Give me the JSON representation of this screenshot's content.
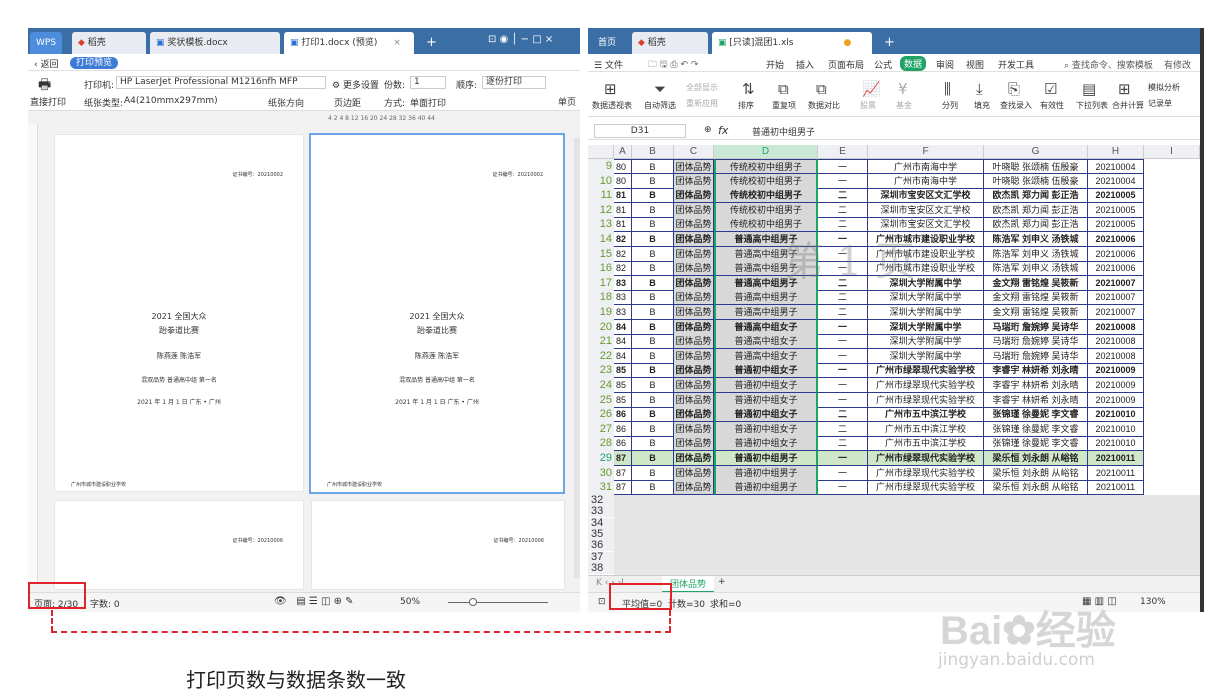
{
  "left_window": {
    "tabs": {
      "wps": "WPS",
      "stencil": "稻壳",
      "doc1": "奖状模板.docx",
      "doc2": "打印1.docx (预览)",
      "add": "+"
    },
    "nav": {
      "back": "返回",
      "preview_badge": "打印预览"
    },
    "toolbar": {
      "print_button": "直接打印",
      "printer_label": "打印机:",
      "printer_value": "HP LaserJet Professional M1216nfh MFP",
      "more_settings": "更多设置",
      "copies_label": "份数:",
      "copies_value": "1",
      "order_label": "顺序:",
      "order_value": "逐份打印",
      "paper_label": "纸张类型:",
      "paper_value": "A4(210mmx297mm)",
      "orientation": "纸张方向",
      "margins": "页边距",
      "mode_label": "方式:",
      "mode_value": "单面打印",
      "single_page": "单页"
    },
    "ruler": "4  2  4  8  12  16  20  24  28  32  36  40  44",
    "page_content": {
      "serial": "证书编号：20210002",
      "serial2": "证书编号：20210006",
      "title1": "2021 全国大众",
      "title2": "跆拳道比赛",
      "names": "陈燕莲   陈浩军",
      "event": "混双品势  普通高中组  第一名",
      "date_place": "2021 年 1 月 1 日  广东 • 广州",
      "footer": "广州市城市建设职业学校"
    },
    "status": {
      "page": "页面: 2/30",
      "words": "字数: 0",
      "zoom": "50%"
    }
  },
  "right_window": {
    "tabs": {
      "home": "首页",
      "stencil": "稻壳",
      "file": "[只读]混团1.xls",
      "add": "+"
    },
    "menu": [
      "文件",
      "开始",
      "插入",
      "页面布局",
      "公式",
      "数据",
      "审阅",
      "视图",
      "开发工具"
    ],
    "menu_active": "数据",
    "search": "查找命令、搜索模板",
    "menu_right": "有修改",
    "ribbon": [
      "数据透视表",
      "自动筛选",
      "全部显示",
      "重新应用",
      "排序",
      "重复项",
      "数据对比",
      "股票",
      "基金",
      "分列",
      "填充",
      "查找录入",
      "有效性",
      "下拉列表",
      "合并计算",
      "模拟分析",
      "记录单"
    ],
    "cell_ref": "D31",
    "fx": "fx",
    "formula": "普通初中组男子",
    "columns": [
      "A",
      "B",
      "C",
      "D",
      "E",
      "F",
      "G",
      "H",
      "I"
    ],
    "rows": [
      {
        "n": "9",
        "a": "80",
        "b": "B",
        "c": "团体品势",
        "d": "传统校初中组男子",
        "e": "一",
        "f": "广州市南海中学",
        "g": "叶晓聪  张颂楠  伍殷豪",
        "h": "20210004",
        "bold": false
      },
      {
        "n": "10",
        "a": "80",
        "b": "B",
        "c": "团体品势",
        "d": "传统校初中组男子",
        "e": "一",
        "f": "广州市南海中学",
        "g": "叶晓聪  张颂楠  伍殷豪",
        "h": "20210004",
        "bold": false
      },
      {
        "n": "11",
        "a": "81",
        "b": "B",
        "c": "团体品势",
        "d": "传统校初中组男子",
        "e": "二",
        "f": "深圳市宝安区文汇学校",
        "g": "欧杰凯  郑力闻  彭正浩",
        "h": "20210005",
        "bold": true
      },
      {
        "n": "12",
        "a": "81",
        "b": "B",
        "c": "团体品势",
        "d": "传统校初中组男子",
        "e": "二",
        "f": "深圳市宝安区文汇学校",
        "g": "欧杰凯  郑力闻  彭正浩",
        "h": "20210005",
        "bold": false
      },
      {
        "n": "13",
        "a": "81",
        "b": "B",
        "c": "团体品势",
        "d": "传统校初中组男子",
        "e": "二",
        "f": "深圳市宝安区文汇学校",
        "g": "欧杰凯  郑力闻  彭正浩",
        "h": "20210005",
        "bold": false
      },
      {
        "n": "14",
        "a": "82",
        "b": "B",
        "c": "团体品势",
        "d": "普通高中组男子",
        "e": "一",
        "f": "广州市城市建设职业学校",
        "g": "陈浩军  刘申义  汤铁城",
        "h": "20210006",
        "bold": true
      },
      {
        "n": "15",
        "a": "82",
        "b": "B",
        "c": "团体品势",
        "d": "普通高中组男子",
        "e": "一",
        "f": "广州市城市建设职业学校",
        "g": "陈浩军  刘申义  汤铁城",
        "h": "20210006",
        "bold": false
      },
      {
        "n": "16",
        "a": "82",
        "b": "B",
        "c": "团体品势",
        "d": "普通高中组男子",
        "e": "一",
        "f": "广州市城市建设职业学校",
        "g": "陈浩军  刘申义  汤铁城",
        "h": "20210006",
        "bold": false
      },
      {
        "n": "17",
        "a": "83",
        "b": "B",
        "c": "团体品势",
        "d": "普通高中组男子",
        "e": "二",
        "f": "深圳大学附属中学",
        "g": "金文翔  雷铭煌  吴筱新",
        "h": "20210007",
        "bold": true
      },
      {
        "n": "18",
        "a": "83",
        "b": "B",
        "c": "团体品势",
        "d": "普通高中组男子",
        "e": "二",
        "f": "深圳大学附属中学",
        "g": "金文翔  雷铭煌  吴筱新",
        "h": "20210007",
        "bold": false
      },
      {
        "n": "19",
        "a": "83",
        "b": "B",
        "c": "团体品势",
        "d": "普通高中组男子",
        "e": "二",
        "f": "深圳大学附属中学",
        "g": "金文翔  雷铭煌  吴筱新",
        "h": "20210007",
        "bold": false
      },
      {
        "n": "20",
        "a": "84",
        "b": "B",
        "c": "团体品势",
        "d": "普通高中组女子",
        "e": "一",
        "f": "深圳大学附属中学",
        "g": "马瑞珩  詹婉婷  吴诗华",
        "h": "20210008",
        "bold": true
      },
      {
        "n": "21",
        "a": "84",
        "b": "B",
        "c": "团体品势",
        "d": "普通高中组女子",
        "e": "一",
        "f": "深圳大学附属中学",
        "g": "马瑞珩  詹婉婷  吴诗华",
        "h": "20210008",
        "bold": false
      },
      {
        "n": "22",
        "a": "84",
        "b": "B",
        "c": "团体品势",
        "d": "普通高中组女子",
        "e": "一",
        "f": "深圳大学附属中学",
        "g": "马瑞珩  詹婉婷  吴诗华",
        "h": "20210008",
        "bold": false
      },
      {
        "n": "23",
        "a": "85",
        "b": "B",
        "c": "团体品势",
        "d": "普通初中组女子",
        "e": "一",
        "f": "广州市绿翠现代实验学校",
        "g": "李睿宇  林妍希  刘永晴",
        "h": "20210009",
        "bold": true
      },
      {
        "n": "24",
        "a": "85",
        "b": "B",
        "c": "团体品势",
        "d": "普通初中组女子",
        "e": "一",
        "f": "广州市绿翠现代实验学校",
        "g": "李睿宇  林妍希  刘永晴",
        "h": "20210009",
        "bold": false
      },
      {
        "n": "25",
        "a": "85",
        "b": "B",
        "c": "团体品势",
        "d": "普通初中组女子",
        "e": "一",
        "f": "广州市绿翠现代实验学校",
        "g": "李睿宇  林妍希  刘永晴",
        "h": "20210009",
        "bold": false
      },
      {
        "n": "26",
        "a": "86",
        "b": "B",
        "c": "团体品势",
        "d": "普通初中组女子",
        "e": "二",
        "f": "广州市五中滨江学校",
        "g": "张锦瑾  徐曼妮  李文睿",
        "h": "20210010",
        "bold": true
      },
      {
        "n": "27",
        "a": "86",
        "b": "B",
        "c": "团体品势",
        "d": "普通初中组女子",
        "e": "二",
        "f": "广州市五中滨江学校",
        "g": "张锦瑾  徐曼妮  李文睿",
        "h": "20210010",
        "bold": false
      },
      {
        "n": "28",
        "a": "86",
        "b": "B",
        "c": "团体品势",
        "d": "普通初中组女子",
        "e": "二",
        "f": "广州市五中滨江学校",
        "g": "张锦瑾  徐曼妮  李文睿",
        "h": "20210010",
        "bold": false
      },
      {
        "n": "29",
        "a": "87",
        "b": "B",
        "c": "团体品势",
        "d": "普通初中组男子",
        "e": "一",
        "f": "广州市绿翠现代实验学校",
        "g": "梁乐恒  刘永朗  从峪铭",
        "h": "20210011",
        "bold": true
      },
      {
        "n": "30",
        "a": "87",
        "b": "B",
        "c": "团体品势",
        "d": "普通初中组男子",
        "e": "一",
        "f": "广州市绿翠现代实验学校",
        "g": "梁乐恒  刘永朗  从峪铭",
        "h": "20210011",
        "bold": false
      },
      {
        "n": "31",
        "a": "87",
        "b": "B",
        "c": "团体品势",
        "d": "普通初中组男子",
        "e": "一",
        "f": "广州市绿翠现代实验学校",
        "g": "梁乐恒  刘永朗  从峪铭",
        "h": "20210011",
        "bold": false
      }
    ],
    "empty_rows": [
      "32",
      "33",
      "34",
      "35",
      "36",
      "37",
      "38"
    ],
    "watermark": "第 1 页",
    "sheet_tab": "团体品势",
    "status": {
      "avg": "平均值=0",
      "count": "计数=30",
      "sum": "求和=0",
      "zoom": "130%"
    }
  },
  "caption": "打印页数与数据条数一致",
  "site_mark": {
    "brand": "Bai",
    "brand2": "经验",
    "url": "jingyan.baidu.com"
  },
  "colors": {
    "accent": "#3a6ea5",
    "highlight": "#e0242b",
    "selection_green": "#21a366",
    "grid_border": "#2a3b8f"
  }
}
